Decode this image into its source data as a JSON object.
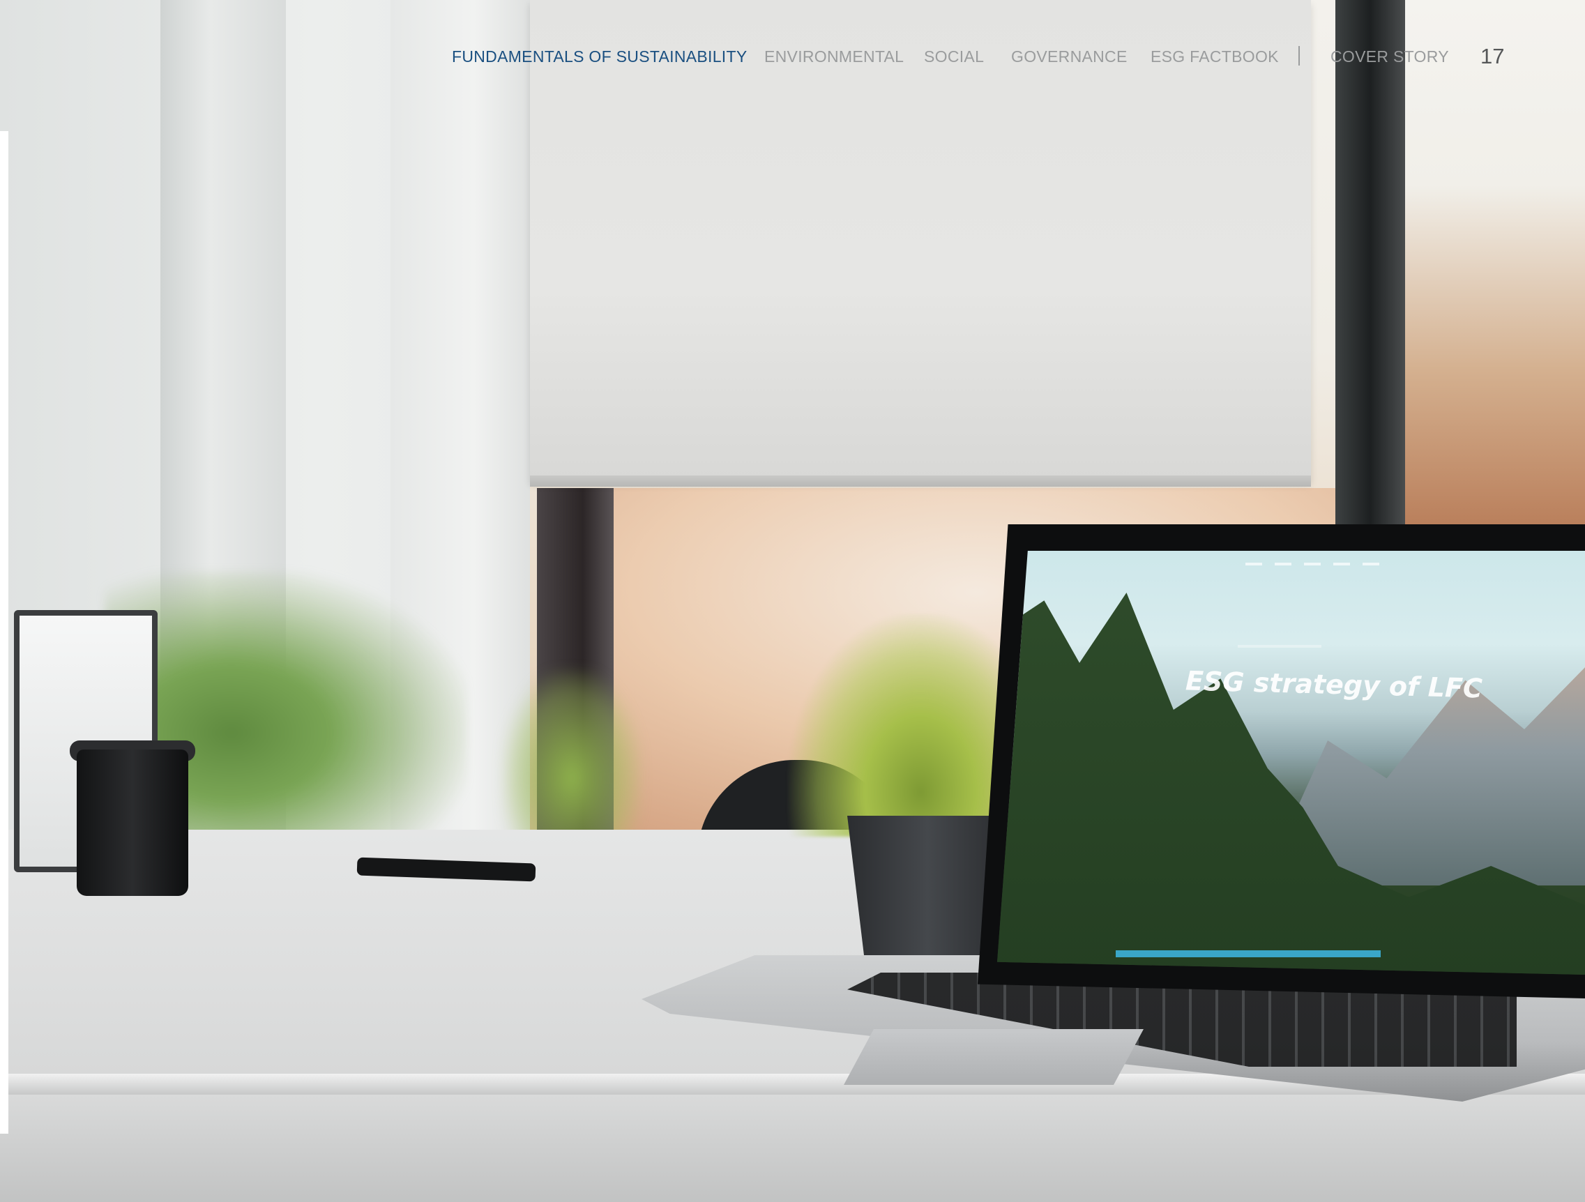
{
  "nav": {
    "items": [
      {
        "label": "FUNDAMENTALS OF SUSTAINABILITY",
        "active": true
      },
      {
        "label": "ENVIRONMENTAL",
        "active": false
      },
      {
        "label": "SOCIAL",
        "active": false
      },
      {
        "label": "GOVERNANCE",
        "active": false
      },
      {
        "label": "ESG FACTBOOK",
        "active": false
      },
      {
        "label": "COVER STORY",
        "active": false
      }
    ],
    "separator": "|"
  },
  "page_number": "17",
  "photo": {
    "laptop_screen_headline": "ESG strategy of LFC"
  },
  "colors": {
    "active_nav": "#1a4f80",
    "inactive_nav": "#9a9c9d",
    "page_number": "#555758"
  }
}
